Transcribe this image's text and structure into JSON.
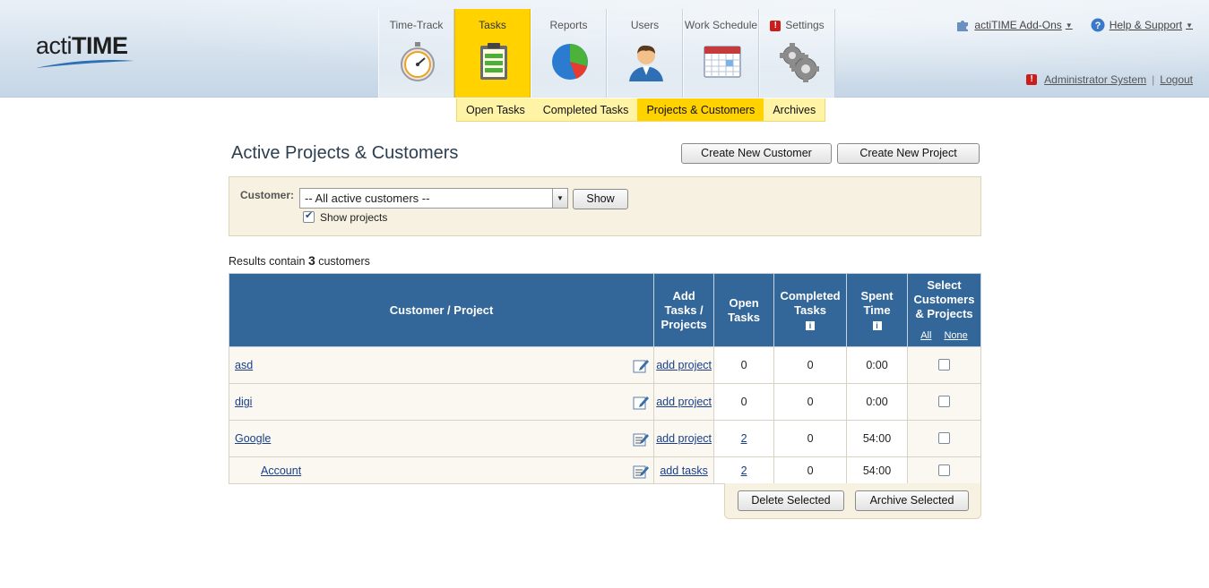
{
  "app": {
    "logo_light": "acti",
    "logo_bold": "TIME"
  },
  "nav": [
    {
      "label": "Time-Track",
      "icon": "stopwatch-icon"
    },
    {
      "label": "Tasks",
      "icon": "clipboard-icon",
      "active": true
    },
    {
      "label": "Reports",
      "icon": "pie-chart-icon"
    },
    {
      "label": "Users",
      "icon": "user-icon"
    },
    {
      "label": "Work Schedule",
      "icon": "calendar-icon"
    },
    {
      "label": "Settings",
      "icon": "gears-icon",
      "badge": "!"
    }
  ],
  "subnav": [
    {
      "label": "Open Tasks"
    },
    {
      "label": "Completed Tasks"
    },
    {
      "label": "Projects & Customers",
      "active": true
    },
    {
      "label": "Archives"
    }
  ],
  "top_right": {
    "addons": "actiTIME Add-Ons",
    "help": "Help & Support",
    "user": "Administrator System",
    "logout": "Logout",
    "warn": "!"
  },
  "page": {
    "title": "Active Projects & Customers",
    "create_customer": "Create New Customer",
    "create_project": "Create New Project"
  },
  "filter": {
    "label": "Customer:",
    "selected": "-- All active customers --",
    "show_button": "Show",
    "show_projects_label": "Show projects",
    "show_projects_checked": true
  },
  "results": {
    "prefix": "Results contain",
    "count": "3",
    "suffix": "customers"
  },
  "table": {
    "headers": {
      "name": "Customer / Project",
      "add": "Add Tasks / Projects",
      "open": "Open Tasks",
      "completed": "Completed Tasks",
      "spent": "Spent Time",
      "select": "Select Customers & Projects",
      "all": "All",
      "none": "None"
    },
    "rows": [
      {
        "name": "asd",
        "add": "add project",
        "open": "0",
        "completed": "0",
        "spent": "0:00"
      },
      {
        "name": "digi",
        "add": "add project",
        "open": "0",
        "completed": "0",
        "spent": "0:00"
      },
      {
        "name": "Google",
        "add": "add project",
        "open": "2",
        "completed": "0",
        "spent": "54:00"
      },
      {
        "name": "Account",
        "add": "add tasks",
        "open": "2",
        "completed": "0",
        "spent": "54:00"
      }
    ]
  },
  "actions": {
    "delete": "Delete Selected",
    "archive": "Archive Selected"
  },
  "colors": {
    "accent": "#ffd200",
    "table_header": "#336699",
    "link": "#1a3f8a"
  }
}
